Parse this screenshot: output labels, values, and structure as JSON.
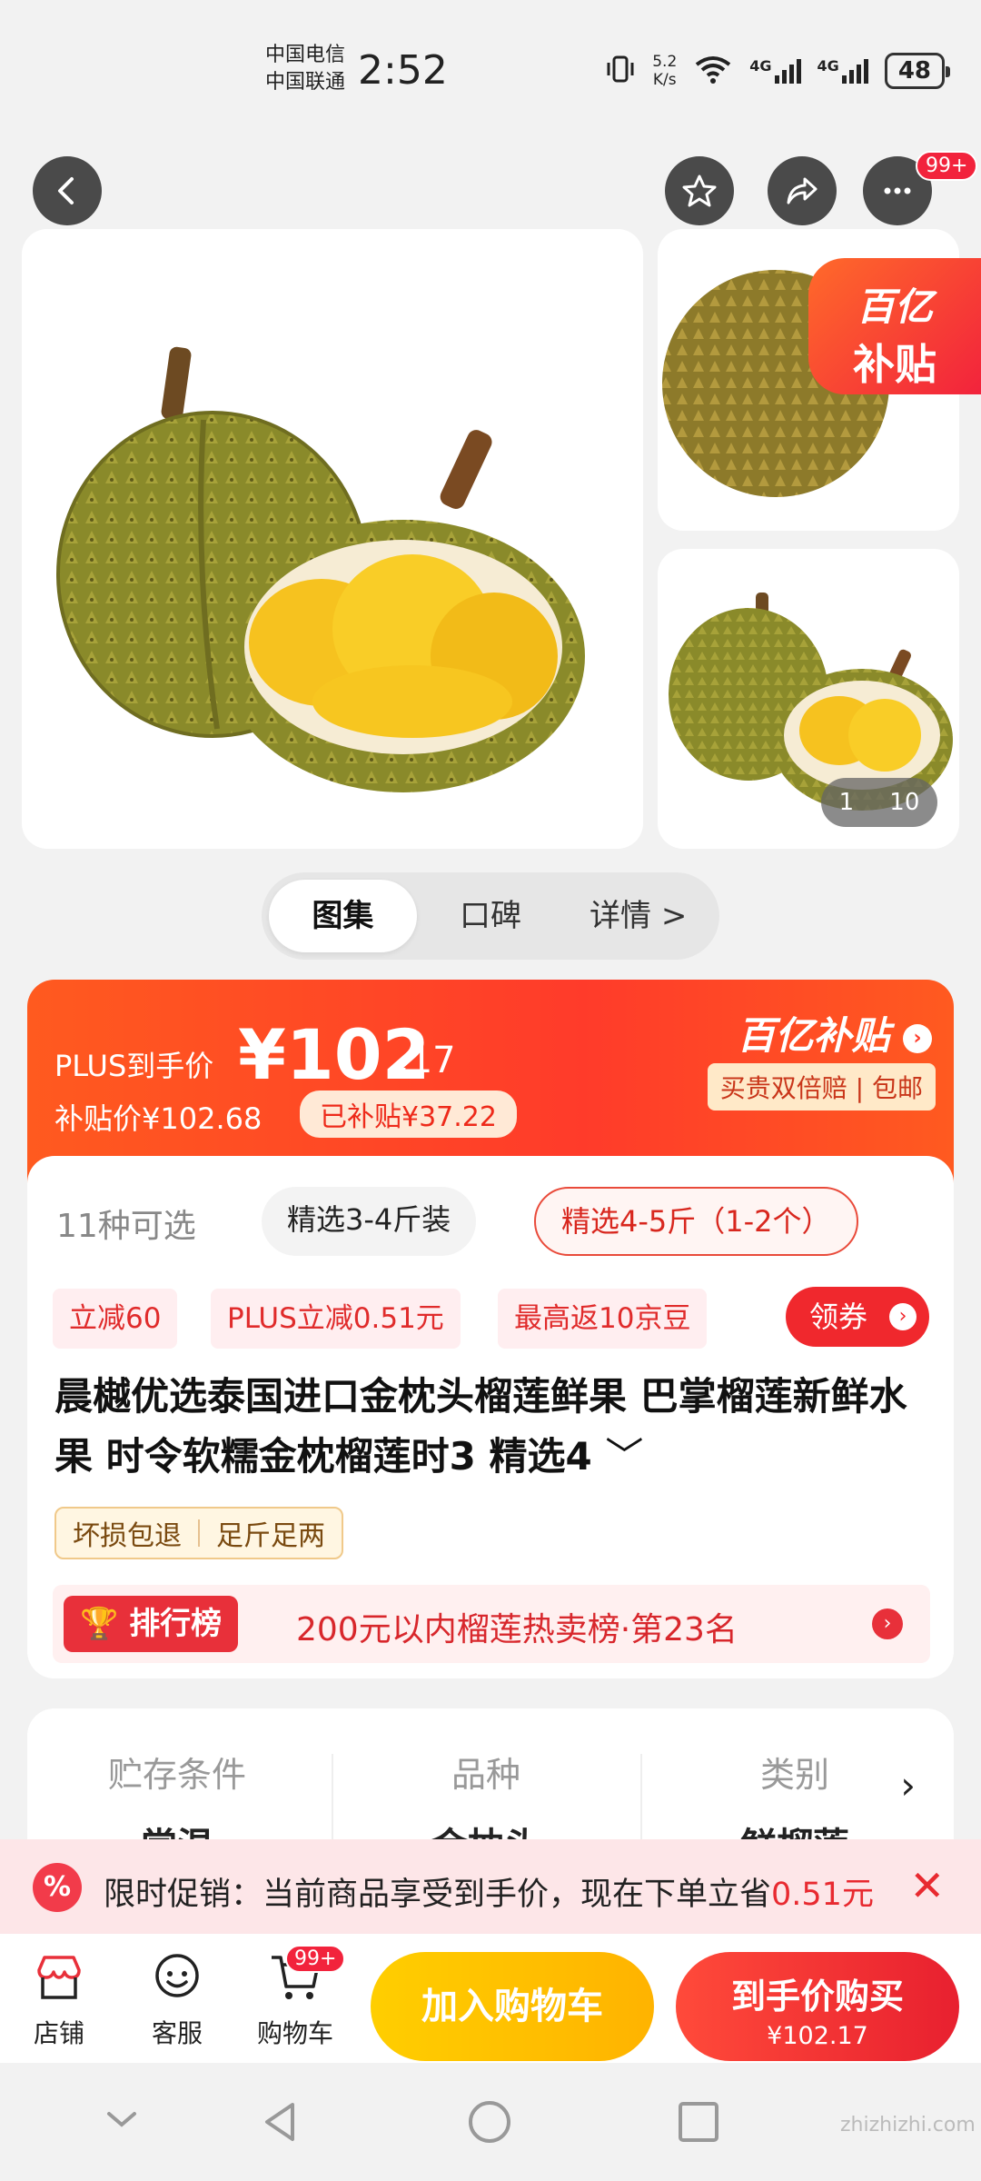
{
  "status": {
    "carrier1": "中国电信",
    "carrier2": "中国联通",
    "time": "2:52",
    "speed_value": "5.2",
    "speed_unit": "K/s",
    "net1": "4G",
    "net2": "4G",
    "battery": "48"
  },
  "gallery": {
    "more_badge": "99+",
    "subsidy_corner_line1": "百亿",
    "subsidy_corner_line2": "补贴",
    "counter_current": "1",
    "counter_total": "10"
  },
  "tabs": [
    {
      "label": "图集"
    },
    {
      "label": "口碑"
    },
    {
      "label": "详情 >"
    }
  ],
  "price": {
    "plus_label": "PLUS到手价",
    "plus_int": "¥102",
    "plus_dec": ".17",
    "subsidy_price": "补贴价¥102.68",
    "subsidy_tag": "已补贴¥37.22",
    "brand": "百亿补贴",
    "brand_sub": "买贵双倍赔 | 包邮"
  },
  "variants": {
    "label": "11种可选",
    "items": [
      "精选3-4斤装",
      "精选4-5斤（1-2个）"
    ]
  },
  "promos": [
    "立减60",
    "PLUS立减0.51元",
    "最高返10京豆"
  ],
  "coupon": "领券",
  "title": "晨樾优选泰国进口金枕头榴莲鲜果 巴掌榴莲新鲜水果 时令软糯金枕榴莲时3 精选4",
  "guarantees": [
    "坏损包退",
    "足斤足两"
  ],
  "rank": {
    "badge": "排行榜",
    "text": "200元以内榴莲热卖榜·第23名"
  },
  "specs": [
    {
      "key": "贮存条件",
      "value": "常温"
    },
    {
      "key": "品种",
      "value": "金枕头"
    },
    {
      "key": "类别",
      "value": "鲜榴莲"
    }
  ],
  "promo_bar": {
    "text": "限时促销：当前商品享受到手价，现在下单立省",
    "amount": "0.51元"
  },
  "bottom": {
    "store": "店铺",
    "service": "客服",
    "cart": "购物车",
    "cart_badge": "99+",
    "add_cart": "加入购物车",
    "buy_label": "到手价购买",
    "buy_price": "¥102.17"
  },
  "watermark": "zhizhizhi.com"
}
